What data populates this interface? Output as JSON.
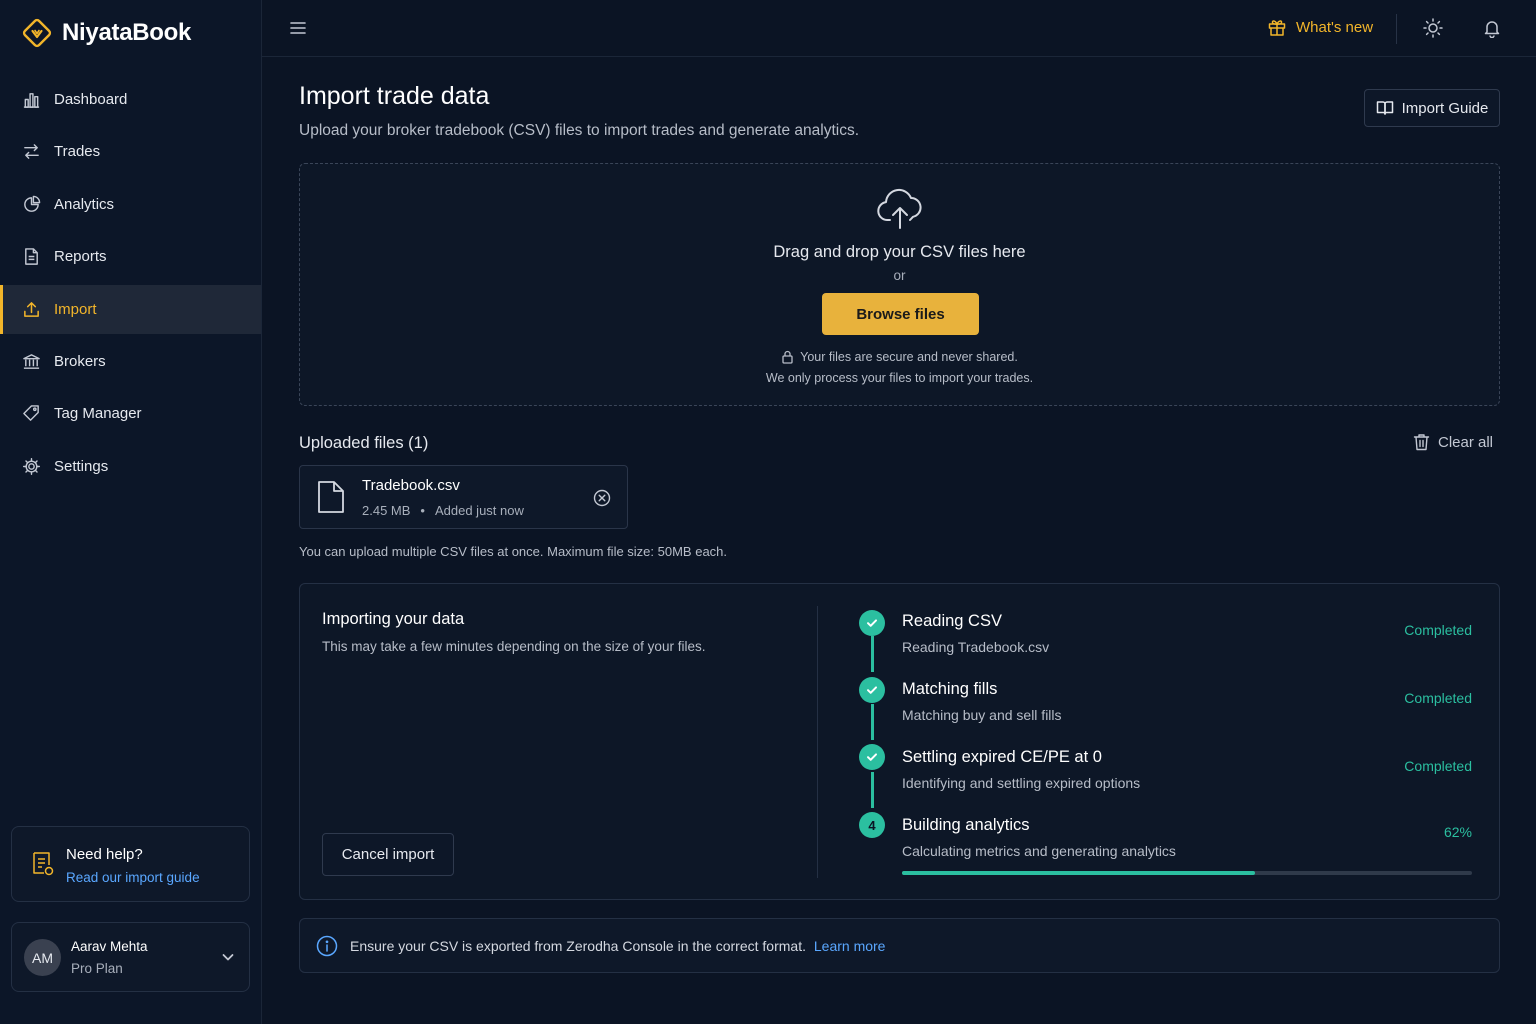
{
  "app": {
    "name": "NiyataBook"
  },
  "sidebar": {
    "items": [
      {
        "label": "Dashboard",
        "icon": "bar-chart-icon"
      },
      {
        "label": "Trades",
        "icon": "arrows-swap-icon"
      },
      {
        "label": "Analytics",
        "icon": "analytics-icon"
      },
      {
        "label": "Reports",
        "icon": "document-icon"
      },
      {
        "label": "Import",
        "icon": "upload-icon",
        "active": true
      },
      {
        "label": "Brokers",
        "icon": "bank-icon"
      },
      {
        "label": "Tag Manager",
        "icon": "tag-icon"
      },
      {
        "label": "Settings",
        "icon": "gear-icon"
      }
    ],
    "help": {
      "title": "Need help?",
      "link": "Read our import guide"
    },
    "user": {
      "initials": "AM",
      "name": "Aarav Mehta",
      "plan": "Pro Plan"
    }
  },
  "topbar": {
    "whats_new": "What's new"
  },
  "page": {
    "title": "Import trade data",
    "subtitle": "Upload your broker tradebook (CSV) files to import trades and generate analytics.",
    "guide_button": "Import Guide"
  },
  "dropzone": {
    "title": "Drag and drop your CSV files here",
    "or": "or",
    "browse": "Browse files",
    "security_line1": "Your files are secure and never shared.",
    "security_line2": "We only process your files to import your trades."
  },
  "uploaded": {
    "title": "Uploaded files (1)",
    "clear_all": "Clear all",
    "files": [
      {
        "name": "Tradebook.csv",
        "size": "2.45 MB",
        "added": "Added just now"
      }
    ],
    "note": "You can upload multiple CSV files at once. Maximum file size: 50MB each."
  },
  "import_progress": {
    "title": "Importing your data",
    "subtitle": "This may take a few minutes depending on the size of your files.",
    "cancel": "Cancel import",
    "steps": [
      {
        "title": "Reading CSV",
        "desc": "Reading Tradebook.csv",
        "status": "Completed"
      },
      {
        "title": "Matching fills",
        "desc": "Matching buy and sell fills",
        "status": "Completed"
      },
      {
        "title": "Settling expired CE/PE at 0",
        "desc": "Identifying and settling expired options",
        "status": "Completed"
      },
      {
        "number": "4",
        "title": "Building analytics",
        "desc": "Calculating metrics and generating analytics",
        "status": "62%",
        "progress": 0.62
      }
    ]
  },
  "info": {
    "text": "Ensure your CSV is exported from Zerodha Console in the correct format.",
    "link": "Learn more"
  },
  "colors": {
    "accent": "#f2b52a",
    "success": "#2bbfa0",
    "link": "#5aa7ff",
    "background": "#0b1424"
  }
}
